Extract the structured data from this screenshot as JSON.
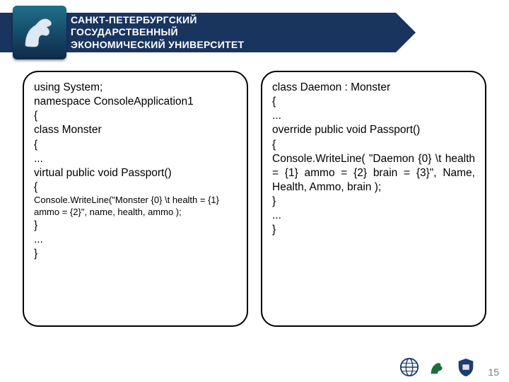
{
  "header": {
    "title": "САНКТ-ПЕТЕРБУРГСКИЙ\nГОСУДАРСТВЕННЫЙ\nЭКОНОМИЧЕСКИЙ УНИВЕРСИТЕТ"
  },
  "code": {
    "left": {
      "l1": "using System;",
      "l2": "namespace ConsoleApplication1",
      "l3": "{",
      "l4": "class Monster",
      "l5": "{",
      "l6": "...",
      "l7": "virtual public void Passport()",
      "l8": "{",
      "l9a": "Console.WriteLine(\"Monster {0} \\t health = {1}",
      "l9b": "ammo = {2}\", name, health, ammo );",
      "l10": "}",
      "l11": "...",
      "l12": " }"
    },
    "right": {
      "l1": "class Daemon : Monster",
      "l2": "{",
      "l3": "...",
      "l4": "override public void Passport()",
      "l5": "{",
      "l6": "Console.WriteLine( \"Daemon {0} \\t health = {1} ammo = {2} brain = {3}\", Name, Health, Ammo, brain );",
      "l7": " }",
      "l8": " ...",
      "l9": "}"
    }
  },
  "footer": {
    "page": "15"
  }
}
